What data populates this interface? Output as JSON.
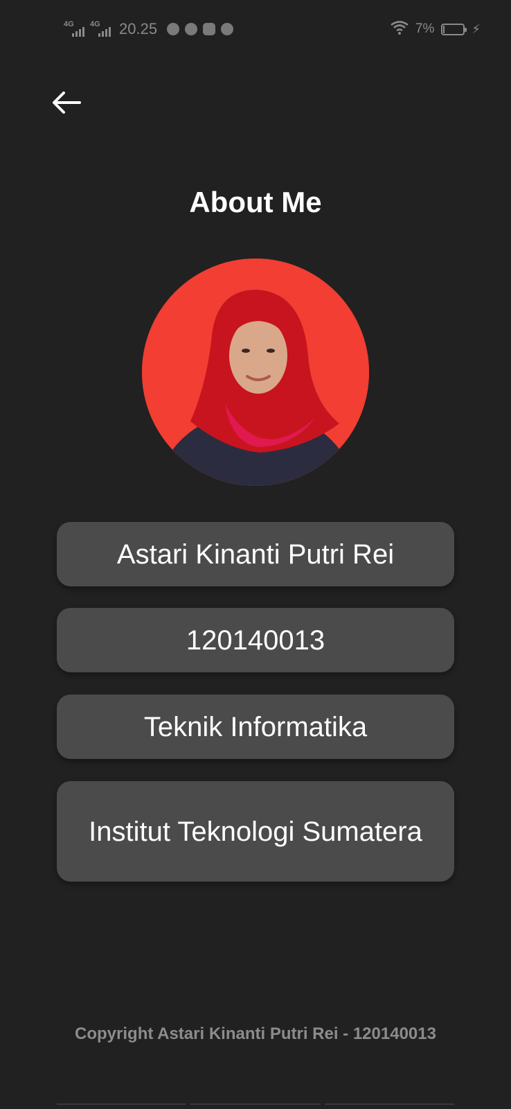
{
  "status_bar": {
    "network_1": "4G",
    "network_2": "4G",
    "time": "20.25",
    "notification_icons": [
      "whatsapp-icon",
      "whatsapp-business-icon",
      "discord-icon",
      "line-icon"
    ],
    "wifi_icon": "wifi-icon",
    "battery_percent": "7%",
    "battery_level": 0.07,
    "charging_icon": "bolt-icon"
  },
  "header": {
    "back_icon": "arrow-left-icon",
    "title": "About Me"
  },
  "profile": {
    "avatar_background": "#f23e33",
    "name": "Astari Kinanti Putri Rei",
    "student_id": "120140013",
    "program": "Teknik Informatika",
    "campus": "Institut Teknologi Sumatera"
  },
  "footer": {
    "copyright": "Copyright Astari Kinanti Putri Rei - 120140013"
  },
  "colors": {
    "background": "#212121",
    "card": "#4b4b4b",
    "text": "#ffffff",
    "muted_text": "#8c8c8c",
    "accent": "#f23e33"
  }
}
